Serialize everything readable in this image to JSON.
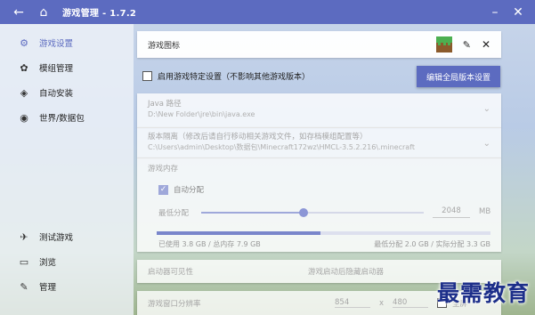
{
  "window": {
    "title": "游戏管理 - 1.7.2",
    "back_icon": "←",
    "home_icon": "⌂",
    "minimize_icon": "–",
    "close_icon": "✕"
  },
  "sidebar": {
    "items": [
      {
        "label": "游戏设置",
        "icon": "⚙",
        "active": true
      },
      {
        "label": "模组管理",
        "icon": "✿",
        "active": false
      },
      {
        "label": "自动安装",
        "icon": "◈",
        "active": false
      },
      {
        "label": "世界/数据包",
        "icon": "◉",
        "active": false
      }
    ],
    "bottom_items": [
      {
        "label": "测试游戏",
        "icon": "✈"
      },
      {
        "label": "浏览",
        "icon": "▭"
      },
      {
        "label": "管理",
        "icon": "✎"
      }
    ]
  },
  "game_icon": {
    "label": "游戏图标",
    "edit_icon": "✎",
    "remove_icon": "✕"
  },
  "specific_settings": {
    "label": "启用游戏特定设置（不影响其他游戏版本）",
    "checked": false
  },
  "global_button": {
    "label": "编辑全局版本设置"
  },
  "java": {
    "title": "Java 路径",
    "path": "D:\\New Folder\\jre\\bin\\java.exe",
    "chevron": "⌄"
  },
  "isolation": {
    "title": "版本隔离（修改后请自行移动相关游戏文件，如存档模组配置等）",
    "path": "C:\\Users\\admin\\Desktop\\数据包\\Minecraft172wz\\HMCL-3.5.2.216\\.minecraft",
    "chevron": "⌄"
  },
  "memory": {
    "title": "游戏内存",
    "auto_label": "自动分配",
    "auto_checked": true,
    "check_mark": "✓",
    "min_label": "最低分配",
    "min_value": "2048",
    "unit": "MB",
    "slider_fraction": 0.46,
    "usage_fraction": 0.49,
    "used_text": "已使用 3.8 GB / 总内存 7.9 GB",
    "alloc_text": "最低分配 2.0 GB / 实际分配 3.3 GB"
  },
  "launcher_visibility": {
    "label": "启动器可见性",
    "value": "游戏启动后隐藏启动器"
  },
  "window_resolution": {
    "label": "游戏窗口分辨率",
    "width": "854",
    "separator": "x",
    "height": "480",
    "fullscreen_label": "全屏"
  },
  "watermark": "最需教育",
  "colors": {
    "accent": "#5c6bc0",
    "accent_light": "#9fa8da"
  }
}
